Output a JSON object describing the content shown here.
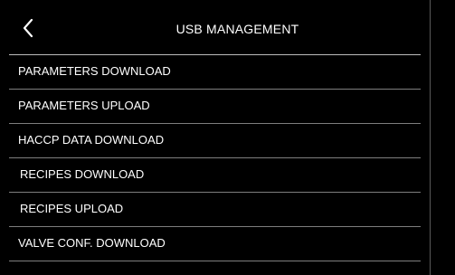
{
  "header": {
    "title": "USB MANAGEMENT",
    "back_icon": "chevron-left-icon"
  },
  "menu": {
    "items": [
      {
        "label": "PARAMETERS DOWNLOAD"
      },
      {
        "label": "PARAMETERS UPLOAD"
      },
      {
        "label": "HACCP DATA DOWNLOAD"
      },
      {
        "label": "RECIPES DOWNLOAD"
      },
      {
        "label": "RECIPES UPLOAD"
      },
      {
        "label": "VALVE CONF. DOWNLOAD"
      }
    ]
  },
  "colors": {
    "background": "#000000",
    "text": "#ffffff",
    "divider": "#7e7e7e"
  }
}
